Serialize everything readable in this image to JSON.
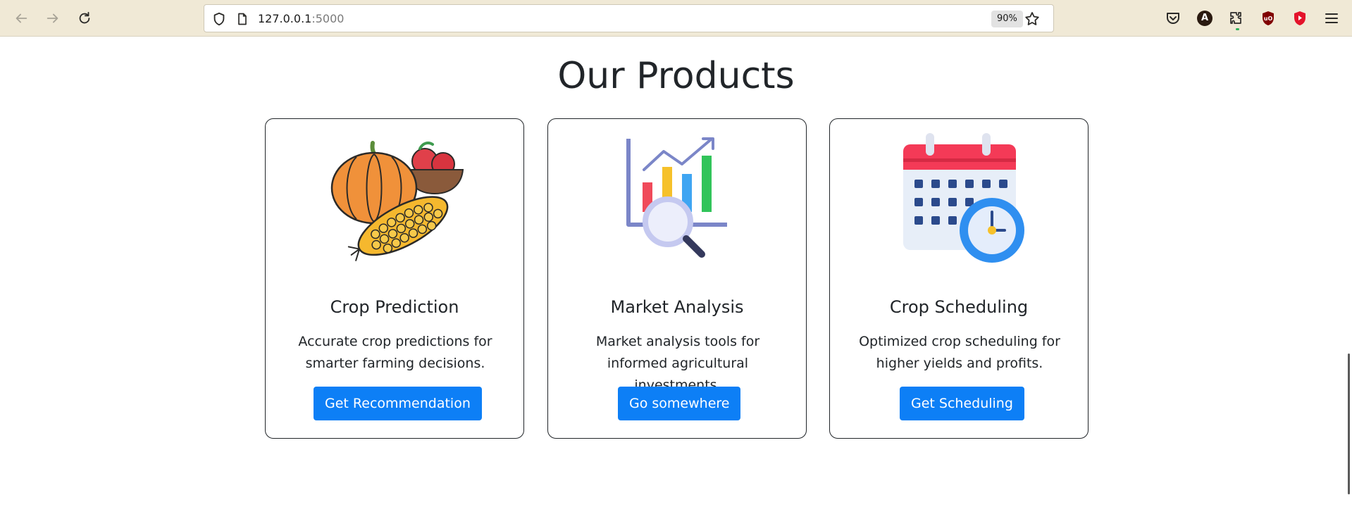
{
  "browser": {
    "url_host": "127.0.0.1",
    "url_port": ":5000",
    "zoom": "90%",
    "profile_initial": "A"
  },
  "page": {
    "title": "Our Products"
  },
  "products": [
    {
      "title": "Crop Prediction",
      "description": "Accurate crop predictions for smarter farming decisions.",
      "button": "Get Recommendation",
      "icon": "produce-illustration"
    },
    {
      "title": "Market Analysis",
      "description": "Market analysis tools for informed agricultural investments.",
      "button": "Go somewhere",
      "icon": "chart-magnifier-illustration"
    },
    {
      "title": "Crop Scheduling",
      "description": "Optimized crop scheduling for higher yields and profits.",
      "button": "Get Scheduling",
      "icon": "calendar-clock-illustration"
    }
  ],
  "colors": {
    "primary_button": "#0d7ff6",
    "chrome_background": "#f0e9d6",
    "text": "#212529"
  }
}
